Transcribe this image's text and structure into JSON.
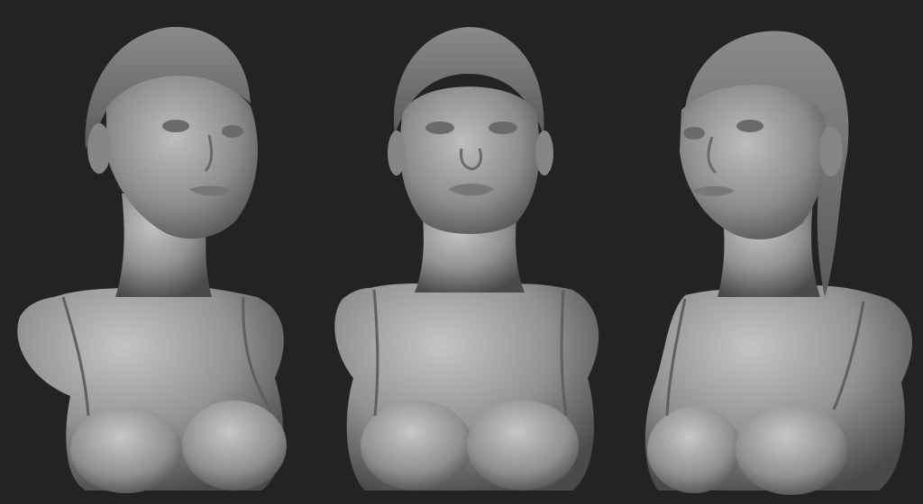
{
  "scene": {
    "background": "#232323",
    "clay_light": "#b9b9b9",
    "clay_mid": "#8e8e8e",
    "clay_dark": "#4a4a4a",
    "views": [
      {
        "name": "three-quarter-left"
      },
      {
        "name": "front"
      },
      {
        "name": "three-quarter-right"
      }
    ]
  }
}
